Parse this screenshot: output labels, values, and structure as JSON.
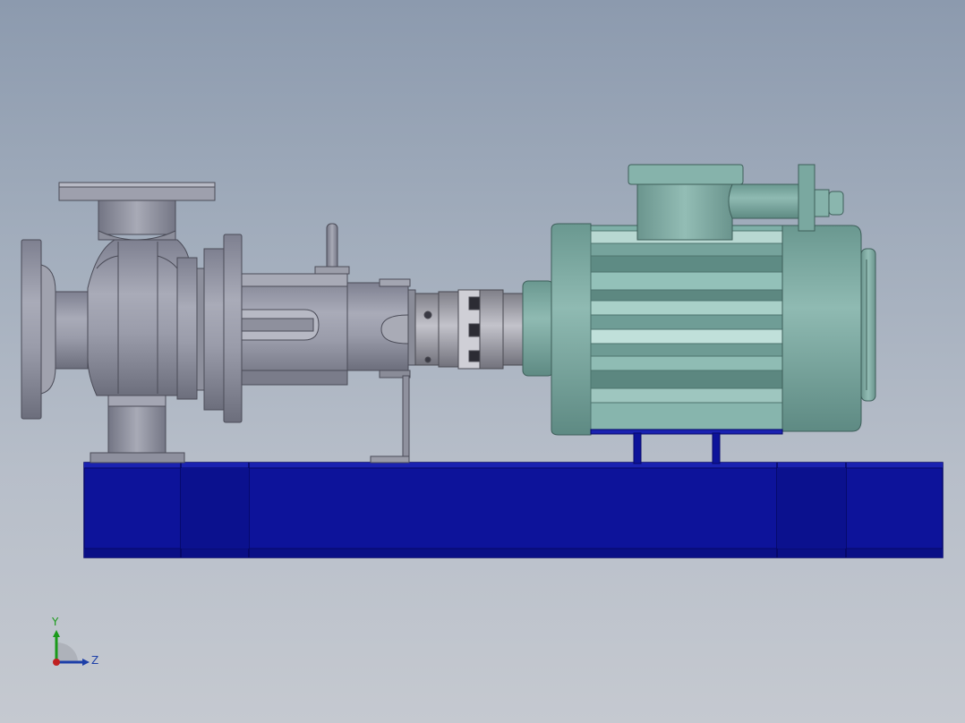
{
  "viewport": {
    "background_top": "#8c9aae",
    "background_bottom": "#c5c9d0"
  },
  "model": {
    "components": [
      "pump-casing",
      "suction-flange",
      "discharge-flange",
      "bearing-bracket",
      "shaft-coupling",
      "electric-motor",
      "terminal-box",
      "base-frame"
    ],
    "colors": {
      "pump": "#8e909e",
      "motor": "#78a59d",
      "base": "#0d139a",
      "coupling": "#9c9ca4"
    }
  },
  "triad": {
    "y_label": "Y",
    "z_label": "Z",
    "x_color": "#c02020",
    "y_color": "#1a9a1a",
    "z_color": "#1d3fa8"
  }
}
